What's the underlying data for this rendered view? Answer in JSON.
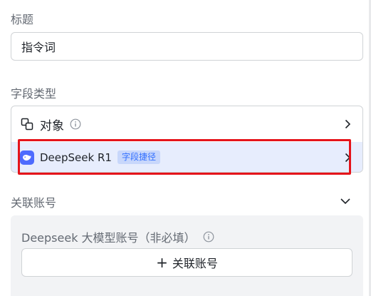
{
  "title_section": {
    "label": "标题",
    "value": "指令词"
  },
  "field_type_section": {
    "label": "字段类型",
    "object_item": {
      "label": "对象",
      "icon": "object-copy-icon"
    },
    "deepseek_item": {
      "label": "DeepSeek R1",
      "badge": "字段捷径",
      "icon": "deepseek-whale-icon"
    }
  },
  "account_section": {
    "label": "关联账号",
    "panel_title": "Deepseek 大模型账号（非必填）",
    "link_button_label": "关联账号"
  },
  "colors": {
    "accent": "#3370ff",
    "deepseek_brand": "#4d6bfe",
    "highlight_red": "#e5141b",
    "selected_row_bg": "#e7edfd"
  }
}
